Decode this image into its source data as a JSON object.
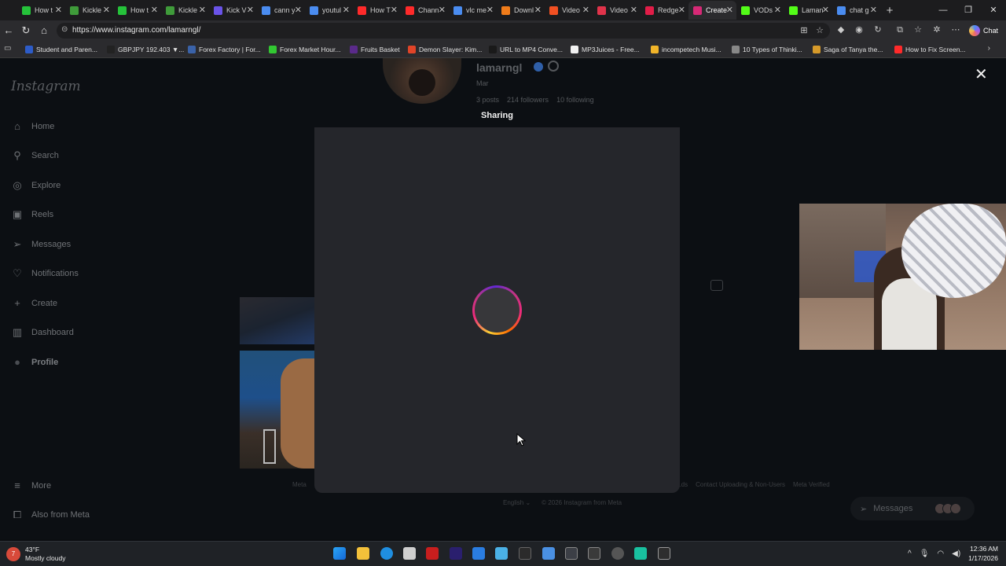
{
  "browser": {
    "tabs": [
      {
        "label": "How t",
        "color": "#25c23a",
        "active": false
      },
      {
        "label": "Kickle",
        "color": "#3f9b3a",
        "active": false
      },
      {
        "label": "How t",
        "color": "#25c23a",
        "active": false
      },
      {
        "label": "Kickle",
        "color": "#3f9b3a",
        "active": false
      },
      {
        "label": "Kick V",
        "color": "#6a53e8",
        "active": false
      },
      {
        "label": "cann y",
        "color": "#4a8cf0",
        "active": false
      },
      {
        "label": "youtul",
        "color": "#4a8cf0",
        "active": false
      },
      {
        "label": "How T",
        "color": "#ff2a2a",
        "active": false
      },
      {
        "label": "Chann",
        "color": "#ff2a2a",
        "active": false
      },
      {
        "label": "vlc me",
        "color": "#4a8cf0",
        "active": false
      },
      {
        "label": "Downl",
        "color": "#f07c1a",
        "active": false
      },
      {
        "label": "Video",
        "color": "#f25022",
        "active": false
      },
      {
        "label": "Video",
        "color": "#e0334a",
        "active": false
      },
      {
        "label": "Redge",
        "color": "#e11d48",
        "active": false
      },
      {
        "label": "Create",
        "color": "#d62976",
        "active": true
      },
      {
        "label": "VODs",
        "color": "#53fc18",
        "active": false
      },
      {
        "label": "Laman",
        "color": "#53fc18",
        "active": false
      },
      {
        "label": "chat g",
        "color": "#4a8cf0",
        "active": false
      }
    ],
    "new_tab": "+",
    "url": "https://www.instagram.com/lamarngl/",
    "chat_label": "Chat",
    "bookmarks": [
      {
        "label": "Student and Paren...",
        "color": "#2d5cc8"
      },
      {
        "label": "GBPJPY 192.403 ▼...",
        "color": "#222222"
      },
      {
        "label": "Forex Factory | For...",
        "color": "#3a62a8"
      },
      {
        "label": "Forex Market Hour...",
        "color": "#32c832"
      },
      {
        "label": "Fruits Basket",
        "color": "#5a2a8a"
      },
      {
        "label": "Demon Slayer: Kim...",
        "color": "#e04428"
      },
      {
        "label": "URL to MP4 Conve...",
        "color": "#1a1a1a"
      },
      {
        "label": "MP3Juices - Free...",
        "color": "#f0f0f0"
      },
      {
        "label": "incompetech Musi...",
        "color": "#f0b429"
      },
      {
        "label": "10 Types of Thinki...",
        "color": "#888888"
      },
      {
        "label": "Saga of Tanya the...",
        "color": "#d69a2a"
      },
      {
        "label": "How to Fix Screen...",
        "color": "#ff2a2a"
      }
    ]
  },
  "instagram": {
    "logo": "Instagram",
    "nav": [
      {
        "label": "Home",
        "icon": "home-icon",
        "glyph": "⌂"
      },
      {
        "label": "Search",
        "icon": "search-icon",
        "glyph": "⚲"
      },
      {
        "label": "Explore",
        "icon": "explore-icon",
        "glyph": "◎"
      },
      {
        "label": "Reels",
        "icon": "reels-icon",
        "glyph": "▣"
      },
      {
        "label": "Messages",
        "icon": "messages-icon",
        "glyph": "➢"
      },
      {
        "label": "Notifications",
        "icon": "heart-icon",
        "glyph": "♡"
      },
      {
        "label": "Create",
        "icon": "plus-icon",
        "glyph": "+"
      },
      {
        "label": "Dashboard",
        "icon": "dashboard-icon",
        "glyph": "▥"
      },
      {
        "label": "Profile",
        "icon": "profile-avatar-icon",
        "glyph": "●"
      }
    ],
    "more_label": "More",
    "also_from_meta": "Also from Meta",
    "profile": {
      "username": "lamarngl",
      "sub": "Mar",
      "posts": "3 posts",
      "followers": "214 followers",
      "following": "10 following"
    },
    "footer": {
      "meta": "Meta",
      "links_right": [
        "...ds",
        "Contact Uploading & Non-Users",
        "Meta Verified"
      ],
      "language": "English ⌄",
      "copyright": "© 2026 Instagram from Meta"
    },
    "messages_pill": "Messages"
  },
  "modal": {
    "title": "Sharing",
    "close_glyph": "✕",
    "state": "loading"
  },
  "taskbar": {
    "weather_temp": "43°F",
    "weather_desc": "Mostly cloudy",
    "weather_badge": "7",
    "time": "12:36 AM",
    "date": "1/17/2026"
  }
}
